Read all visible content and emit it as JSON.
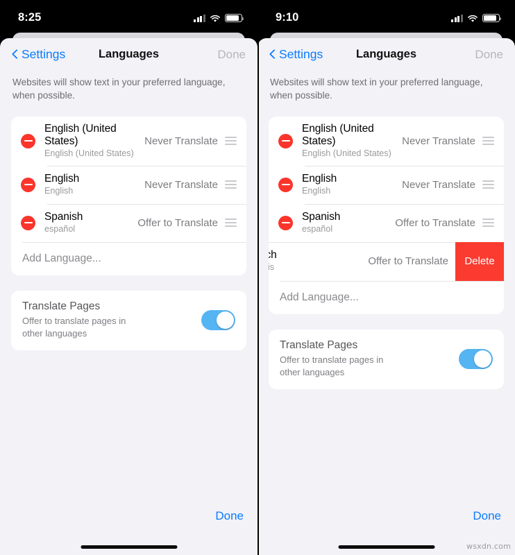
{
  "colors": {
    "accent_blue": "#0a7cff",
    "destructive_red": "#fb352b",
    "delete_red": "#fb3b30",
    "toggle_on": "#55b4f2",
    "sheet_bg": "#f2f2f7",
    "card_bg": "#ffffff",
    "secondary_text": "#8a8a8e"
  },
  "watermark": "wsxdn.com",
  "panels": [
    {
      "id": "left",
      "status": {
        "time": "8:25",
        "cellular_icon": "cellular-signal-icon",
        "wifi_icon": "wifi-icon",
        "battery_icon": "battery-icon"
      },
      "nav": {
        "back_icon": "chevron-left-icon",
        "back_label": "Settings",
        "title": "Languages",
        "done_label": "Done"
      },
      "blurb": "Websites will show text in your preferred language, when possible.",
      "languages": [
        {
          "name": "English (United States)",
          "native": "English (United States)",
          "mode": "Never Translate",
          "remove_icon": "minus-circle-icon",
          "reorder_icon": "reorder-grip-icon"
        },
        {
          "name": "English",
          "native": "English",
          "mode": "Never Translate",
          "remove_icon": "minus-circle-icon",
          "reorder_icon": "reorder-grip-icon"
        },
        {
          "name": "Spanish",
          "native": "español",
          "mode": "Offer to Translate",
          "remove_icon": "minus-circle-icon",
          "reorder_icon": "reorder-grip-icon"
        }
      ],
      "swiped_row": null,
      "add_language_label": "Add Language...",
      "translate_pages": {
        "title": "Translate Pages",
        "subtitle": "Offer to translate pages in other languages",
        "toggle_state": "on"
      },
      "bottom_done_label": "Done"
    },
    {
      "id": "right",
      "status": {
        "time": "9:10",
        "cellular_icon": "cellular-signal-icon",
        "wifi_icon": "wifi-icon",
        "battery_icon": "battery-icon"
      },
      "nav": {
        "back_icon": "chevron-left-icon",
        "back_label": "Settings",
        "title": "Languages",
        "done_label": "Done"
      },
      "blurb": "Websites will show text in your preferred language, when possible.",
      "languages": [
        {
          "name": "English (United States)",
          "native": "English (United States)",
          "mode": "Never Translate",
          "remove_icon": "minus-circle-icon",
          "reorder_icon": "reorder-grip-icon"
        },
        {
          "name": "English",
          "native": "English",
          "mode": "Never Translate",
          "remove_icon": "minus-circle-icon",
          "reorder_icon": "reorder-grip-icon"
        },
        {
          "name": "Spanish",
          "native": "español",
          "mode": "Offer to Translate",
          "remove_icon": "minus-circle-icon",
          "reorder_icon": "reorder-grip-icon"
        }
      ],
      "swiped_row": {
        "name": "French",
        "native": "français",
        "mode": "Offer to Translate",
        "reorder_icon": "reorder-grip-icon",
        "delete_label": "Delete"
      },
      "add_language_label": "Add Language...",
      "translate_pages": {
        "title": "Translate Pages",
        "subtitle": "Offer to translate pages in other languages",
        "toggle_state": "on"
      },
      "bottom_done_label": "Done"
    }
  ]
}
